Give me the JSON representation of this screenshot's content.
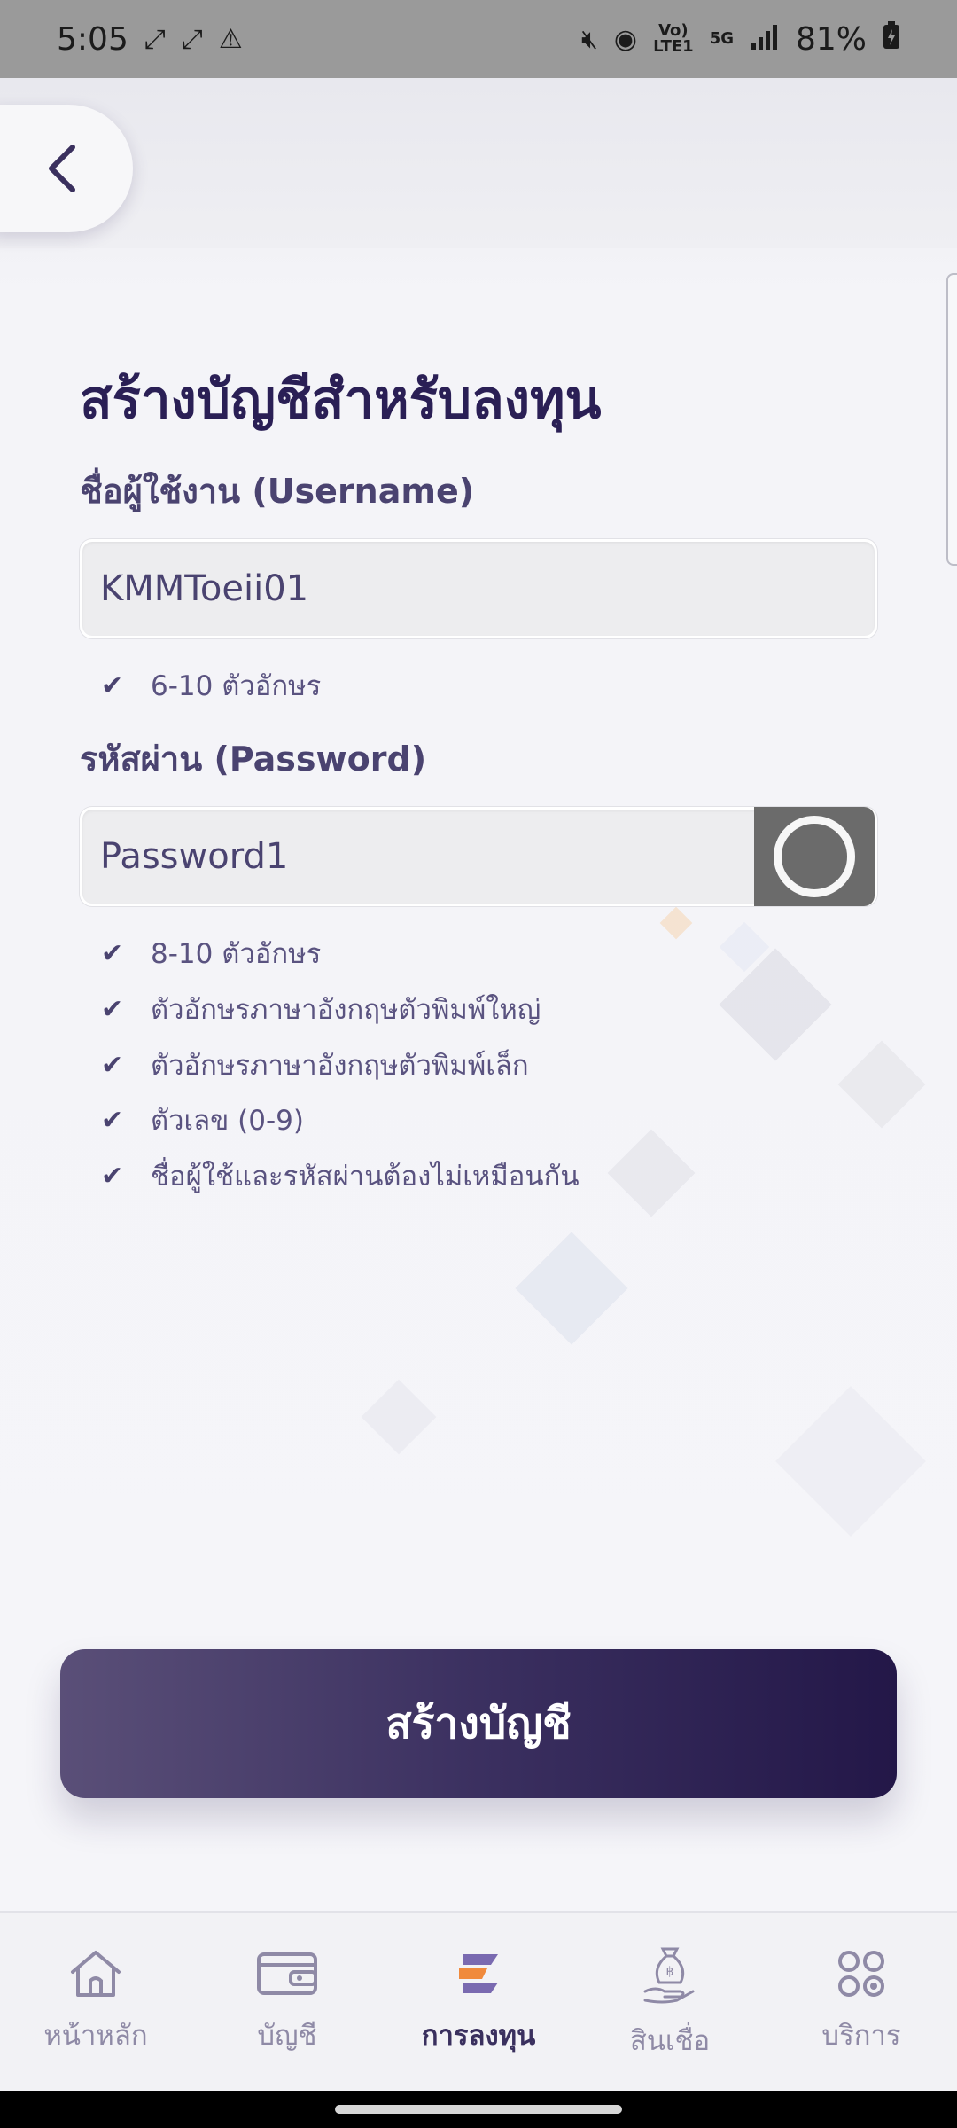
{
  "status_bar": {
    "time": "5:05",
    "network_top": "Vo)",
    "network_bottom": "LTE1",
    "network_5g": "5G",
    "battery": "81%"
  },
  "page": {
    "title": "สร้างบัญชีสำหรับลงทุน"
  },
  "username": {
    "label": "ชื่อผู้ใช้งาน (Username)",
    "value": "KMMToeii01",
    "rules": [
      "6-10 ตัวอักษร"
    ]
  },
  "password": {
    "label": "รหัสผ่าน (Password)",
    "value": "Password1",
    "rules": [
      "8-10 ตัวอักษร",
      "ตัวอักษรภาษาอังกฤษตัวพิมพ์ใหญ่",
      "ตัวอักษรภาษาอังกฤษตัวพิมพ์เล็ก",
      "ตัวเลข (0-9)",
      "ชื่อผู้ใช้และรหัสผ่านต้องไม่เหมือนกัน"
    ]
  },
  "create_button": {
    "label": "สร้างบัญชี"
  },
  "bottom_nav": [
    {
      "label": "หน้าหลัก",
      "icon": "home-icon"
    },
    {
      "label": "บัญชี",
      "icon": "wallet-icon"
    },
    {
      "label": "การลงทุน",
      "icon": "invest-icon",
      "active": true
    },
    {
      "label": "สินเชื่อ",
      "icon": "loan-icon"
    },
    {
      "label": "บริการ",
      "icon": "services-icon"
    }
  ],
  "colors": {
    "primary": "#2a1f55",
    "button_gradient_start": "#5a4f78",
    "button_gradient_end": "#231748",
    "accent_orange": "#f08a3c",
    "nav_inactive": "#8f8aa6"
  }
}
